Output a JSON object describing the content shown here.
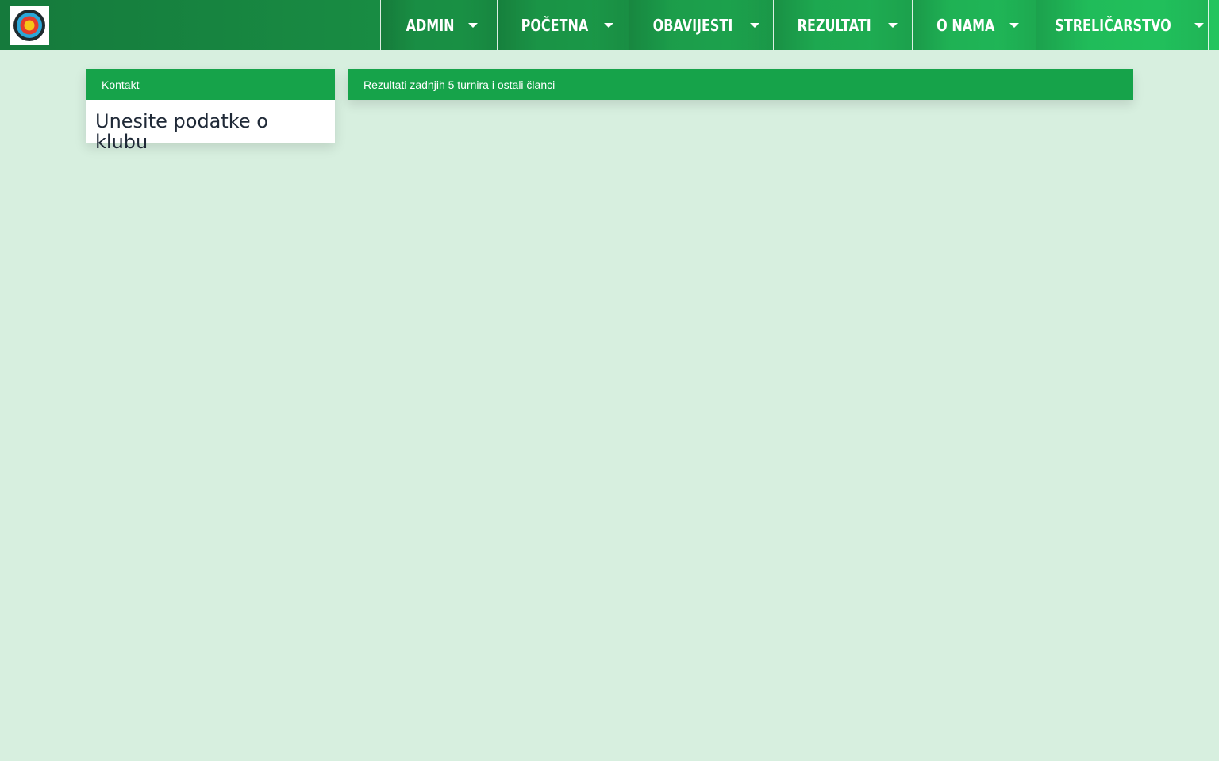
{
  "logo": {
    "icon": "archery-target-icon"
  },
  "nav": [
    {
      "label": "ADMIN",
      "icon": "caret-down-icon"
    },
    {
      "label": "POČETNA",
      "icon": "caret-down-icon"
    },
    {
      "label": "OBAVIJESTI",
      "icon": "caret-down-icon"
    },
    {
      "label": "REZULTATI",
      "icon": "caret-down-icon"
    },
    {
      "label": "O NAMA",
      "icon": "caret-down-icon"
    },
    {
      "label": "STRELIČARSTVO",
      "icon": "caret-down-icon"
    }
  ],
  "contact_panel": {
    "title": "Kontakt",
    "body": "Unesite podatke o klubu"
  },
  "results_panel": {
    "title": "Rezultati zadnjih 5 turnira i ostali članci"
  },
  "colors": {
    "accent": "#16a34a",
    "background": "#d7efdf"
  }
}
